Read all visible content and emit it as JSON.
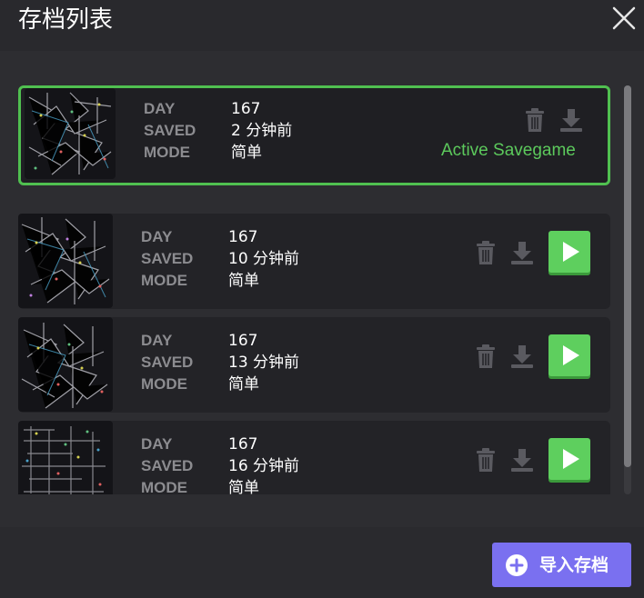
{
  "window": {
    "title": "存档列表",
    "close_icon": "close-icon"
  },
  "labels": {
    "day": "DAY",
    "saved": "SAVED",
    "mode": "MODE"
  },
  "saves": [
    {
      "day": "167",
      "saved": "2 分钟前",
      "mode": "简单",
      "active": true,
      "status": "Active Savegame"
    },
    {
      "day": "167",
      "saved": "10 分钟前",
      "mode": "简单",
      "active": false
    },
    {
      "day": "167",
      "saved": "13 分钟前",
      "mode": "简单",
      "active": false
    },
    {
      "day": "167",
      "saved": "16 分钟前",
      "mode": "简单",
      "active": false
    }
  ],
  "footer": {
    "import_label": "导入存档",
    "import_icon": "plus-circle-icon"
  },
  "colors": {
    "accent_green": "#5ecf5e",
    "import_purple": "#7a70f0",
    "active_border": "#50c050"
  }
}
